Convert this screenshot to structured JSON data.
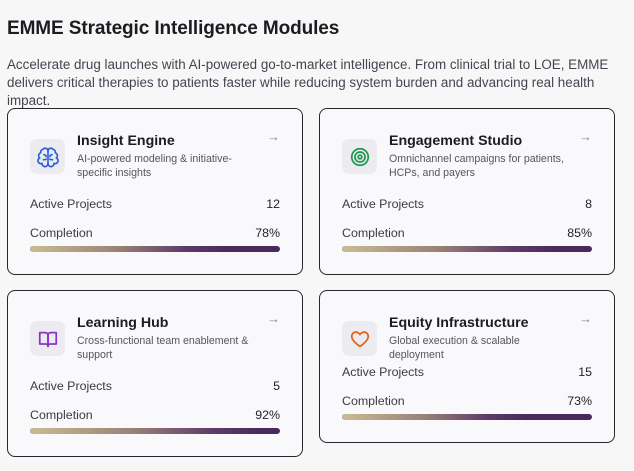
{
  "page": {
    "title": "EMME Strategic Intelligence Modules",
    "description": "Accelerate drug launches with AI-powered go-to-market intelligence. From clinical trial to LOE, EMME delivers critical therapies to patients faster while reducing system burden and advancing real health impact."
  },
  "labels": {
    "active_projects": "Active Projects",
    "completion": "Completion",
    "arrow": "→"
  },
  "modules": [
    {
      "title": "Insight Engine",
      "subtitle": "AI-powered modeling & initiative-specific insights",
      "icon": "brain-icon",
      "icon_color": "#2c5fd6",
      "active_projects": "12",
      "completion_text": "78%",
      "completion": 78
    },
    {
      "title": "Engagement Studio",
      "subtitle": "Omnichannel campaigns for patients, HCPs, and payers",
      "icon": "target-icon",
      "icon_color": "#1f9a4f",
      "active_projects": "8",
      "completion_text": "85%",
      "completion": 85
    },
    {
      "title": "Learning Hub",
      "subtitle": "Cross-functional team enablement & support",
      "icon": "book-icon",
      "icon_color": "#8b32c8",
      "active_projects": "5",
      "completion_text": "92%",
      "completion": 92
    },
    {
      "title": "Equity Infrastructure",
      "subtitle": "Global execution & scalable deployment",
      "icon": "heart-icon",
      "icon_color": "#e0641f",
      "active_projects": "15",
      "completion_text": "73%",
      "completion": 73
    }
  ]
}
